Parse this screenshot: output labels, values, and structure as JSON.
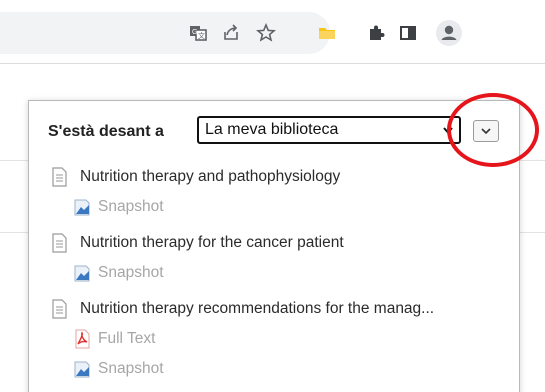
{
  "popup": {
    "saving_label": "S'està desant a",
    "library_select": "La meva biblioteca"
  },
  "items": [
    {
      "title": "Nutrition therapy and pathophysiology",
      "attachments": [
        {
          "type": "snapshot",
          "label": "Snapshot"
        }
      ]
    },
    {
      "title": "Nutrition therapy for the cancer patient",
      "attachments": [
        {
          "type": "snapshot",
          "label": "Snapshot"
        }
      ]
    },
    {
      "title": "Nutrition therapy recommendations for the manag...",
      "attachments": [
        {
          "type": "pdf",
          "label": "Full Text"
        },
        {
          "type": "snapshot",
          "label": "Snapshot"
        }
      ]
    }
  ],
  "toolbar_icons": [
    "translate-icon",
    "share-icon",
    "star-icon",
    "folder-extension-icon",
    "puzzle-extensions-icon",
    "side-panel-icon",
    "profile-icon"
  ],
  "colors": {
    "highlight_circle": "#e5151b",
    "pdf_icon": "#e0322f",
    "snapshot_icon": "#3a78c2"
  }
}
